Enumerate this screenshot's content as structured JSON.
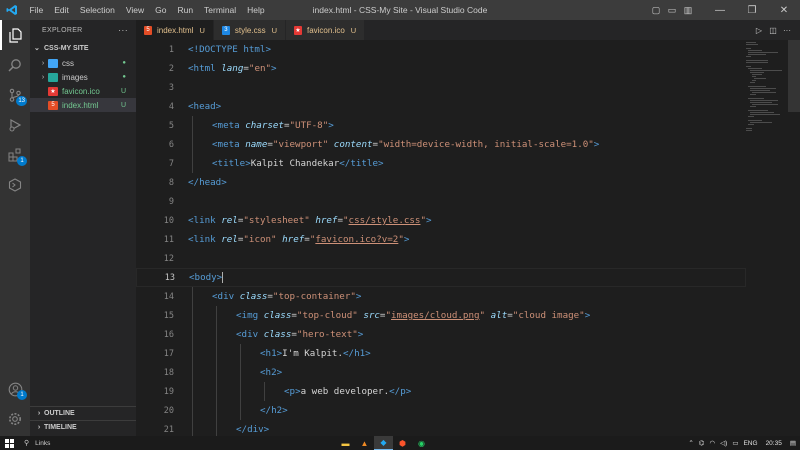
{
  "titlebar": {
    "title": "index.html - CSS-My Site - Visual Studio Code",
    "menu": [
      "File",
      "Edit",
      "Selection",
      "View",
      "Go",
      "Run",
      "Terminal",
      "Help"
    ]
  },
  "activity": {
    "scm_badge": "13",
    "extensions_badge": "1",
    "accounts_badge": "1"
  },
  "sidebar": {
    "header": "EXPLORER",
    "more": "···",
    "section": "CSS-MY SITE",
    "items": [
      {
        "label": "css",
        "status": "●",
        "type": "folder"
      },
      {
        "label": "images",
        "status": "●",
        "type": "folder"
      },
      {
        "label": "favicon.ico",
        "status": "U",
        "type": "file"
      },
      {
        "label": "index.html",
        "status": "U",
        "type": "file"
      }
    ],
    "outline": "OUTLINE",
    "timeline": "TIMELINE"
  },
  "tabs": [
    {
      "label": "index.html",
      "status": "U",
      "icon": "html-icon"
    },
    {
      "label": "style.css",
      "status": "U",
      "icon": "css-icon"
    },
    {
      "label": "favicon.ico",
      "status": "U",
      "icon": "image-icon"
    }
  ],
  "editor": {
    "line_numbers": [
      "1",
      "2",
      "3",
      "4",
      "5",
      "6",
      "7",
      "8",
      "9",
      "10",
      "11",
      "12",
      "13",
      "14",
      "15",
      "16",
      "17",
      "18",
      "19",
      "20",
      "21"
    ],
    "current_line": "13",
    "strings": {
      "doctype": "<!DOCTYPE html>",
      "html_open": "<html",
      "lang_attr": "lang",
      "lang_val": "\"en\"",
      "head_open": "<head>",
      "meta": "<meta",
      "charset_attr": "charset",
      "charset_val": "\"UTF-8\"",
      "name_attr": "name",
      "name_val": "\"viewport\"",
      "content_attr": "content",
      "content_val": "\"width=device-width, initial-scale=1.0\"",
      "title_open": "<title>",
      "title_text": "Kalpit Chandekar",
      "title_close": "</title>",
      "head_close": "</head>",
      "link": "<link",
      "rel_attr": "rel",
      "rel_stylesheet": "\"stylesheet\"",
      "href_attr": "href",
      "href_css": "css/style.css",
      "rel_icon": "\"icon\"",
      "href_icon": "favicon.ico?v=2",
      "body_open": "<body>",
      "div_open": "<div",
      "class_attr": "class",
      "top_container": "\"top-container\"",
      "img": "<img",
      "top_cloud": "\"top-cloud\"",
      "src_attr": "src",
      "src_val": "images/cloud.png",
      "alt_attr": "alt",
      "alt_val": "\"cloud image\"",
      "hero_text": "\"hero-text\"",
      "h1_open": "<h1>",
      "h1_text": "I'm Kalpit.",
      "h1_close": "</h1>",
      "h2_open": "<h2>",
      "p_open": "<p>",
      "p_text": "a web developer.",
      "p_close": "</p>",
      "h2_close": "</h2>",
      "div_close": "</div>"
    }
  },
  "taskbar": {
    "search": "Links",
    "language": "ENG",
    "time": "20:35"
  },
  "colors": {
    "accent": "#007acc",
    "tag": "#569cd6",
    "attr": "#9cdcfe",
    "string": "#ce9178",
    "modified": "#e2c08d"
  }
}
